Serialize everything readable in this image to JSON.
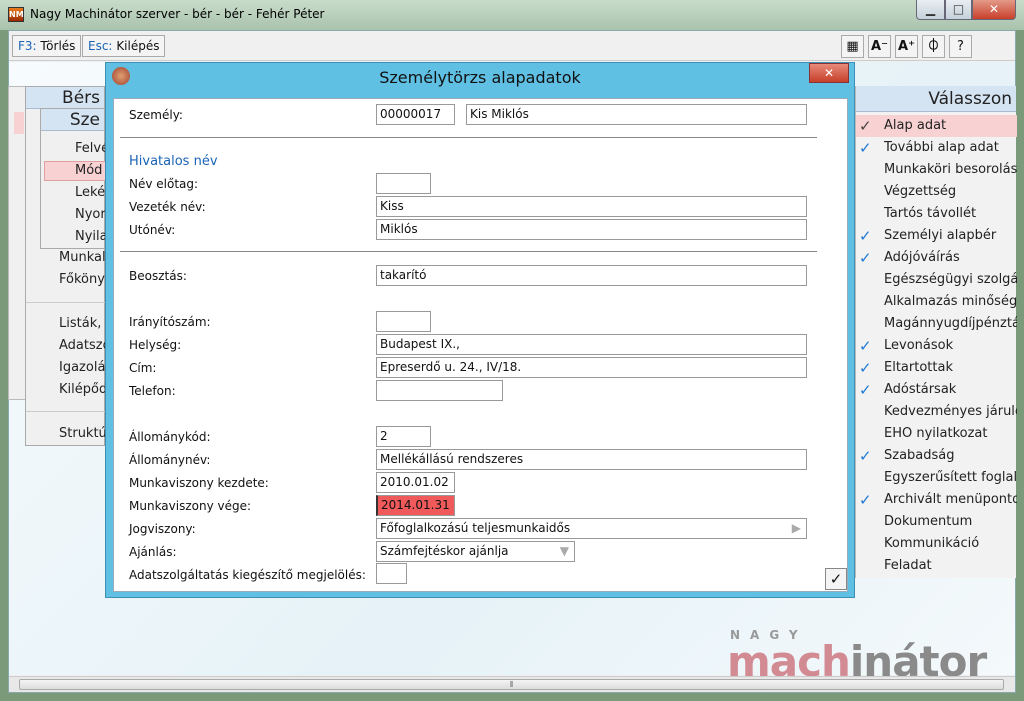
{
  "window": {
    "title": "Nagy Machinátor szerver - bér - bér - Fehér Péter",
    "app_icon": "NM",
    "controls": {
      "minimize": "▁",
      "maximize": "□",
      "close": "✕"
    }
  },
  "toolbar": {
    "delete_key": "F3:",
    "delete_label": "Törlés",
    "exit_key": "Esc:",
    "exit_label": "Kilépés",
    "icons": {
      "layout": "▦",
      "font_smaller": "A⁻",
      "font_larger": "A⁺",
      "globe": "⏀",
      "help": "?"
    }
  },
  "left_panel": {
    "title": "Bérs",
    "sub_title": "Sze",
    "sub_items": [
      "Felvé",
      "Mód",
      "Leké",
      "Nyor",
      "Nyila"
    ],
    "items": [
      "Munkal",
      "Főköny",
      "Listák, l",
      "Adatszo",
      "Igazolás",
      "Kilépőd",
      "Struktú"
    ]
  },
  "right_panel": {
    "title": "Válasszon",
    "items": [
      {
        "label": "Alap adat",
        "checked": true,
        "selected": true
      },
      {
        "label": "További alap adat",
        "checked": true
      },
      {
        "label": "Munkaköri besorolás",
        "checked": false
      },
      {
        "label": "Végzettség",
        "checked": false
      },
      {
        "label": "Tartós távollét",
        "checked": false
      },
      {
        "label": "Személyi alapbér",
        "checked": true
      },
      {
        "label": "Adójóváírás",
        "checked": true
      },
      {
        "label": "Egészségügyi szolgálta",
        "checked": false
      },
      {
        "label": "Alkalmazás minősége",
        "checked": false
      },
      {
        "label": "Magánnyugdíjpénztár",
        "checked": false
      },
      {
        "label": "Levonások",
        "checked": true
      },
      {
        "label": "Eltartottak",
        "checked": true
      },
      {
        "label": "Adóstársak",
        "checked": true
      },
      {
        "label": "Kedvezményes járulék",
        "checked": false
      },
      {
        "label": "EHO nyilatkozat",
        "checked": false
      },
      {
        "label": "Szabadság",
        "checked": true
      },
      {
        "label": "Egyszerűsített foglalko",
        "checked": false
      },
      {
        "label": "Archivált menüpontok",
        "checked": true
      },
      {
        "label": "Dokumentum",
        "checked": false
      },
      {
        "label": "Kommunikáció",
        "checked": false
      },
      {
        "label": "Feladat",
        "checked": false
      }
    ]
  },
  "dialog": {
    "title": "Személytörzs alapadatok",
    "close": "✕",
    "szemely_label": "Személy:",
    "szemely_id": "00000017",
    "szemely_name": "Kis Miklós",
    "section_official_name": "Hivatalos név",
    "nev_elotag_label": "Név előtag:",
    "nev_elotag": "",
    "vezeteknev_label": "Vezeték név:",
    "vezeteknev": "Kiss",
    "utonev_label": "Utónév:",
    "utonev": "Miklós",
    "beosztas_label": "Beosztás:",
    "beosztas": "takarító",
    "iranyitoszam_label": "Irányítószám:",
    "iranyitoszam": "",
    "helyseg_label": "Helység:",
    "helyseg": "Budapest IX.,",
    "cim_label": "Cím:",
    "cim": "Epreserdő u. 24., IV/18.",
    "telefon_label": "Telefon:",
    "telefon": "",
    "allomanykod_label": "Állománykód:",
    "allomanykod": "2",
    "allomanynev_label": "Állománynév:",
    "allomanynev": "Mellékállású rendszeres",
    "kezdete_label": "Munkaviszony kezdete:",
    "kezdete": "2010.01.02",
    "vege_label": "Munkaviszony vége:",
    "vege": "2014.01.31",
    "jogviszony_label": "Jogviszony:",
    "jogviszony": "Főfoglalkozású teljesmunkaidős",
    "ajanlas_label": "Ajánlás:",
    "ajanlas": "Számfejtéskor ajánlja",
    "adatszolg_label": "Adatszolgáltatás kiegészítő megjelölés:",
    "adatszolg": "",
    "ok": "✓",
    "error_color": "#f05a5a"
  },
  "logo": {
    "top": "NAGY",
    "mach": "mach",
    "inator": "inátor"
  },
  "scrollbar": {
    "grip": "⦀"
  }
}
